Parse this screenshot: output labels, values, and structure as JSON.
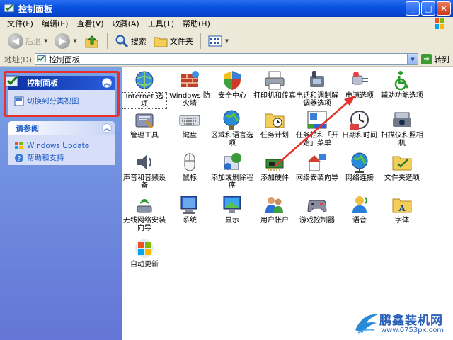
{
  "window": {
    "title": "控制面板"
  },
  "menu": [
    "文件(F)",
    "编辑(E)",
    "查看(V)",
    "收藏(A)",
    "工具(T)",
    "帮助(H)"
  ],
  "toolbar": {
    "back": "后退",
    "search": "搜索",
    "folders": "文件夹"
  },
  "address": {
    "label": "地址(D)",
    "value": "控制面板",
    "go": "转到"
  },
  "left_pane": {
    "panel1": {
      "title": "控制面板",
      "link": "切换到分类视图"
    },
    "panel2": {
      "title": "请参阅",
      "links": [
        "Windows Update",
        "帮助和支持"
      ]
    }
  },
  "icons": [
    {
      "label": "Internet 选项",
      "icon": "globe-gear-icon"
    },
    {
      "label": "Windows 防火墙",
      "icon": "firewall-icon"
    },
    {
      "label": "安全中心",
      "icon": "shield-icon"
    },
    {
      "label": "打印机和传真",
      "icon": "printer-icon"
    },
    {
      "label": "电话和调制解调器选项",
      "icon": "phone-icon"
    },
    {
      "label": "电源选项",
      "icon": "power-plug-icon"
    },
    {
      "label": "辅助功能选项",
      "icon": "accessibility-icon"
    },
    {
      "label": "管理工具",
      "icon": "admin-tools-icon"
    },
    {
      "label": "键盘",
      "icon": "keyboard-icon"
    },
    {
      "label": "区域和语言选项",
      "icon": "globe-clock-icon"
    },
    {
      "label": "任务计划",
      "icon": "scheduled-tasks-icon"
    },
    {
      "label": "任务栏和「开始」菜单",
      "icon": "taskbar-icon"
    },
    {
      "label": "日期和时间",
      "icon": "clock-icon"
    },
    {
      "label": "扫描仪和照相机",
      "icon": "camera-icon"
    },
    {
      "label": "声音和音频设备",
      "icon": "speaker-icon"
    },
    {
      "label": "鼠标",
      "icon": "mouse-icon"
    },
    {
      "label": "添加或删除程序",
      "icon": "add-remove-icon"
    },
    {
      "label": "添加硬件",
      "icon": "hardware-icon"
    },
    {
      "label": "网络安装向导",
      "icon": "network-wizard-icon"
    },
    {
      "label": "网络连接",
      "icon": "network-icon"
    },
    {
      "label": "文件夹选项",
      "icon": "folder-options-icon"
    },
    {
      "label": "无线网络安装向导",
      "icon": "wireless-icon"
    },
    {
      "label": "系统",
      "icon": "system-icon"
    },
    {
      "label": "显示",
      "icon": "display-icon"
    },
    {
      "label": "用户帐户",
      "icon": "users-icon"
    },
    {
      "label": "游戏控制器",
      "icon": "gamepad-icon"
    },
    {
      "label": "语音",
      "icon": "speech-icon"
    },
    {
      "label": "字体",
      "icon": "fonts-icon"
    },
    {
      "label": "自动更新",
      "icon": "windows-update-icon"
    }
  ],
  "watermark": {
    "brand": "鹏鑫装机网",
    "url": "www.0753px.com"
  }
}
